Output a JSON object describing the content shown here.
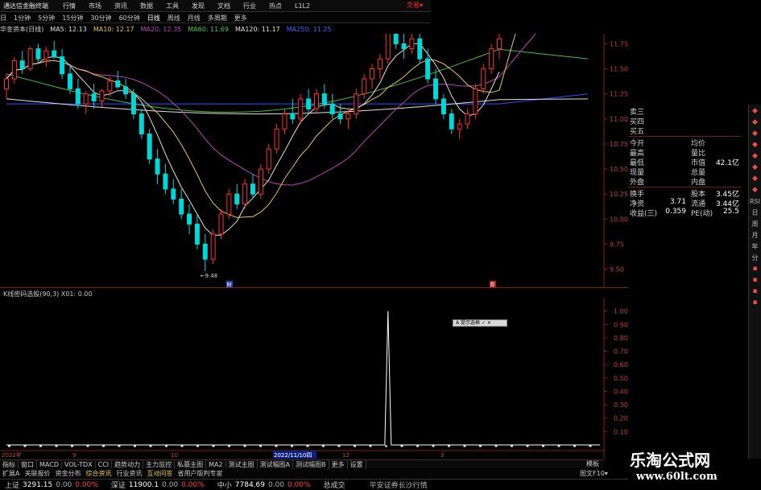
{
  "app": {
    "title": "通达信金融终端",
    "menus": [
      "行情",
      "市场",
      "资讯",
      "数据",
      "工具",
      "发现",
      "文档",
      "行业",
      "热点",
      "L1L2"
    ],
    "right_label": "交易▾"
  },
  "periods": {
    "items": [
      "日",
      "1分钟",
      "5分钟",
      "15分钟",
      "30分钟",
      "60分钟",
      "日线",
      "周线",
      "月线",
      "多周期",
      "更多"
    ],
    "active_index": 6
  },
  "ma_legend": {
    "items": [
      {
        "label": "华金资本(日线)",
        "color": "#d0d0d0"
      },
      {
        "label": "MA5: 12.13",
        "color": "#e0e0e0"
      },
      {
        "label": "MA10: 12.17",
        "color": "#e6c844"
      },
      {
        "label": "MA20: 12.35",
        "color": "#c040c0"
      },
      {
        "label": "MA60: 11.69",
        "color": "#40d040"
      },
      {
        "label": "MA120: 11.17",
        "color": "#e0e0e0"
      },
      {
        "label": "MA250: 11.25",
        "color": "#4060ff"
      }
    ]
  },
  "chart_data": [
    {
      "type": "candlestick",
      "title": "华金资本(日线)",
      "y_ticks": [
        11.75,
        11.5,
        11.25,
        11.0,
        10.75,
        10.5,
        10.25,
        10.0,
        9.75,
        9.5
      ],
      "ylim": [
        9.4,
        11.85
      ],
      "low_label": "9.48",
      "markers": [
        "财",
        "券"
      ],
      "colors": {
        "up": "#ff3030",
        "down": "#00d8d8",
        "ma5": "#e0e0e0",
        "ma10": "#e6c844",
        "ma20": "#c040c0",
        "ma60": "#40c040",
        "ma120": "#e0e0e0",
        "ma250": "#3050ff"
      },
      "candles": [
        [
          11.3,
          11.45,
          11.2,
          11.4
        ],
        [
          11.4,
          11.62,
          11.35,
          11.58
        ],
        [
          11.58,
          11.68,
          11.45,
          11.5
        ],
        [
          11.5,
          11.72,
          11.48,
          11.7
        ],
        [
          11.7,
          11.75,
          11.55,
          11.6
        ],
        [
          11.6,
          11.72,
          11.52,
          11.68
        ],
        [
          11.68,
          11.78,
          11.6,
          11.62
        ],
        [
          11.62,
          11.7,
          11.4,
          11.45
        ],
        [
          11.45,
          11.55,
          11.25,
          11.3
        ],
        [
          11.3,
          11.4,
          11.1,
          11.15
        ],
        [
          11.15,
          11.28,
          11.05,
          11.25
        ],
        [
          11.25,
          11.35,
          11.1,
          11.18
        ],
        [
          11.18,
          11.3,
          11.12,
          11.28
        ],
        [
          11.28,
          11.42,
          11.22,
          11.38
        ],
        [
          11.38,
          11.48,
          11.3,
          11.32
        ],
        [
          11.32,
          11.4,
          11.2,
          11.25
        ],
        [
          11.25,
          11.3,
          11.0,
          11.05
        ],
        [
          11.05,
          11.1,
          10.8,
          10.85
        ],
        [
          10.85,
          10.9,
          10.55,
          10.6
        ],
        [
          10.6,
          10.7,
          10.35,
          10.45
        ],
        [
          10.45,
          10.55,
          10.25,
          10.3
        ],
        [
          10.3,
          10.4,
          10.15,
          10.2
        ],
        [
          10.2,
          10.3,
          10.0,
          10.05
        ],
        [
          10.05,
          10.15,
          9.85,
          9.95
        ],
        [
          9.95,
          10.05,
          9.7,
          9.75
        ],
        [
          9.75,
          9.85,
          9.48,
          9.6
        ],
        [
          9.6,
          9.9,
          9.55,
          9.85
        ],
        [
          9.85,
          10.1,
          9.8,
          10.05
        ],
        [
          10.05,
          10.3,
          10.0,
          10.25
        ],
        [
          10.25,
          10.35,
          10.1,
          10.15
        ],
        [
          10.15,
          10.4,
          10.1,
          10.35
        ],
        [
          10.35,
          10.45,
          10.2,
          10.25
        ],
        [
          10.25,
          10.55,
          10.2,
          10.5
        ],
        [
          10.5,
          10.75,
          10.45,
          10.7
        ],
        [
          10.7,
          10.95,
          10.65,
          10.9
        ],
        [
          10.9,
          11.1,
          10.85,
          11.05
        ],
        [
          11.05,
          11.2,
          10.95,
          11.0
        ],
        [
          11.0,
          11.25,
          10.95,
          11.2
        ],
        [
          11.2,
          11.3,
          11.05,
          11.1
        ],
        [
          11.1,
          11.3,
          11.05,
          11.25
        ],
        [
          11.25,
          11.35,
          11.1,
          11.15
        ],
        [
          11.15,
          11.25,
          11.0,
          11.05
        ],
        [
          11.05,
          11.15,
          10.95,
          11.0
        ],
        [
          11.0,
          11.1,
          10.9,
          11.05
        ],
        [
          11.05,
          11.3,
          11.0,
          11.25
        ],
        [
          11.25,
          11.45,
          11.2,
          11.4
        ],
        [
          11.4,
          11.55,
          11.3,
          11.5
        ],
        [
          11.5,
          11.65,
          11.4,
          11.6
        ],
        [
          11.6,
          11.95,
          11.55,
          11.9
        ],
        [
          11.9,
          12.0,
          11.7,
          11.75
        ],
        [
          11.75,
          11.85,
          11.6,
          11.7
        ],
        [
          11.7,
          11.88,
          11.65,
          11.8
        ],
        [
          11.8,
          11.85,
          11.55,
          11.6
        ],
        [
          11.6,
          11.7,
          11.35,
          11.4
        ],
        [
          11.4,
          11.5,
          11.15,
          11.2
        ],
        [
          11.2,
          11.25,
          11.0,
          11.05
        ],
        [
          11.05,
          11.1,
          10.85,
          10.9
        ],
        [
          10.9,
          11.0,
          10.8,
          10.95
        ],
        [
          10.95,
          11.1,
          10.9,
          11.05
        ],
        [
          11.05,
          11.35,
          11.0,
          11.3
        ],
        [
          11.3,
          11.55,
          11.25,
          11.5
        ],
        [
          11.5,
          11.75,
          11.45,
          11.7
        ],
        [
          11.7,
          11.85,
          11.6,
          11.8
        ]
      ]
    },
    {
      "type": "line",
      "title": "K线密码选股(90,3)",
      "series": [
        {
          "name": "X01",
          "value_label": "X01: 0.00"
        }
      ],
      "y_ticks": [
        1.0,
        0.9,
        0.8,
        0.7,
        0.6,
        0.5,
        0.4,
        0.3,
        0.2,
        0.1
      ],
      "ylim": [
        0,
        1.1
      ],
      "spike_index": 48,
      "spike_value": 1.0,
      "x_labels": [
        "2022年",
        "9",
        "10",
        "2022/11/10四",
        "12",
        "3"
      ]
    }
  ],
  "quote": {
    "rows": [
      {
        "l1": "卖三",
        "v1": "",
        "l2": "",
        "v2": ""
      },
      {
        "l1": "买四",
        "v1": "",
        "l2": "",
        "v2": ""
      },
      {
        "l1": "买五",
        "v1": "",
        "l2": "",
        "v2": ""
      },
      {
        "sep": true
      },
      {
        "l1": "今开",
        "v1": "",
        "l2": "均价",
        "v2": ""
      },
      {
        "l1": "最高",
        "v1": "",
        "l2": "量比",
        "v2": ""
      },
      {
        "l1": "最低",
        "v1": "",
        "l2": "市值",
        "v2": "42.1亿"
      },
      {
        "l1": "现量",
        "v1": "",
        "l2": "总量",
        "v2": ""
      },
      {
        "l1": "外盘",
        "v1": "",
        "l2": "内盘",
        "v2": ""
      },
      {
        "sep": true
      },
      {
        "l1": "换手",
        "v1": "",
        "l2": "股本",
        "v2": "3.45亿"
      },
      {
        "l1": "净资",
        "v1": "3.71",
        "l2": "流通",
        "v2": "3.44亿"
      },
      {
        "l1": "收益(三)",
        "v1": "0.359",
        "l2": "PE(动)",
        "v2": "25.5"
      }
    ]
  },
  "toolbar": {
    "items": [
      "RSI",
      "日",
      "周",
      "月",
      "年",
      "分"
    ]
  },
  "tabs": {
    "items": [
      "指标",
      "窗口",
      "MACD",
      "VOL-TDX",
      "CCI",
      "趋势动力",
      "主力监控",
      "私募主图",
      "MA2",
      "测试主图",
      "测试幅图A",
      "测试幅图B",
      "更多",
      "设置"
    ],
    "right": "模板"
  },
  "news": {
    "items": [
      {
        "label": "扩展A",
        "hl": false
      },
      {
        "label": "关联报价",
        "hl": false
      },
      {
        "label": "资金分布",
        "hl": false
      },
      {
        "label": "综合资讯",
        "hl": true
      },
      {
        "label": "行业资讯",
        "hl": false
      },
      {
        "label": "互动问答",
        "hl": true
      },
      {
        "label": "省用户版判专家",
        "hl": false
      }
    ],
    "right": "图文F10▾"
  },
  "status": {
    "items": [
      {
        "label": "上证",
        "value": "3291.15",
        "extra": "0.00",
        "pct": "0.00%"
      },
      {
        "label": "深证",
        "value": "11900.1",
        "extra": "0.00",
        "pct": "0.00%"
      },
      {
        "label": "中小",
        "value": "7784.69",
        "extra": "0.00",
        "pct": "0.00%"
      }
    ],
    "total_label": "总成交",
    "broker": "平安证券长沙行情"
  },
  "watermark": {
    "title": "乐淘公式网",
    "url": "www.60lt.com"
  },
  "popup": {
    "label": "A 提示选框 ✓ ✕"
  }
}
